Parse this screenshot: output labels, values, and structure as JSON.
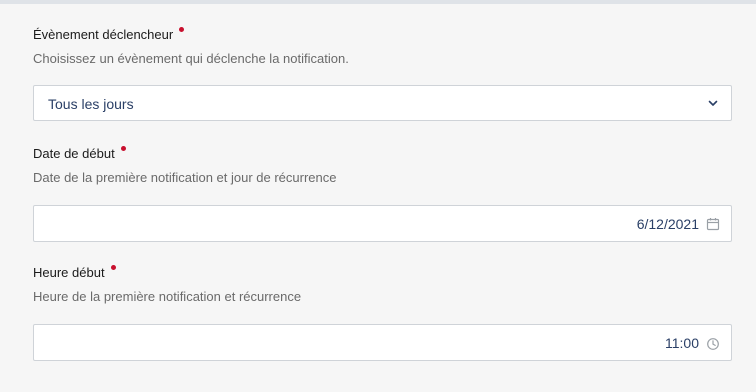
{
  "event_field": {
    "label": "Évènement déclencheur",
    "help": "Choisissez un évènement qui déclenche la notification.",
    "value": "Tous les jours",
    "icon": "chevron-down-icon"
  },
  "start_date_field": {
    "label": "Date de début",
    "help": "Date de la première notification et jour de récurrence",
    "value": "6/12/2021",
    "icon": "calendar-icon"
  },
  "start_time_field": {
    "label": "Heure début",
    "help": "Heure de la première notification et récurrence",
    "value": "11:00",
    "icon": "clock-icon"
  },
  "colors": {
    "required": "#c8102e",
    "value_text": "#2a3f66",
    "border": "#cfd3d8",
    "background": "#f6f6f6"
  }
}
